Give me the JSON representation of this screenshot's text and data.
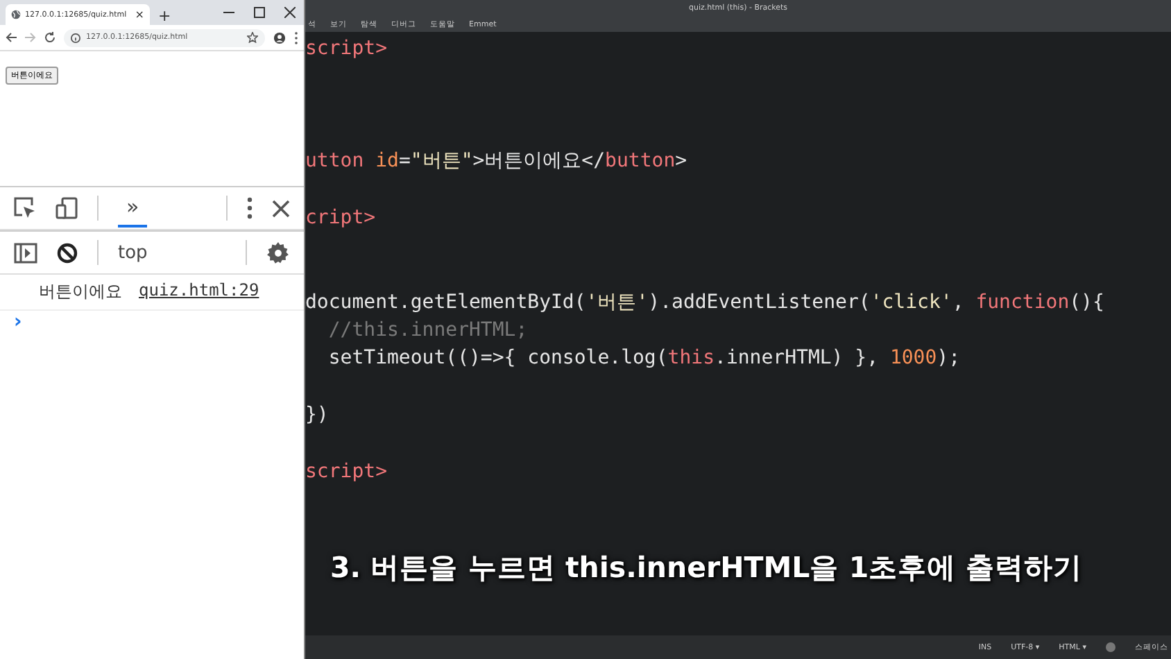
{
  "browser": {
    "tab_title": "127.0.0.1:12685/quiz.html",
    "tab_close": "×",
    "new_tab": "+",
    "address": "127.0.0.1:12685/quiz.html",
    "page_button": "버튼이에요"
  },
  "devtools": {
    "tabs": [
      {
        "label": "»",
        "selected": true
      }
    ],
    "context": "top",
    "console": [
      {
        "message": "버튼이에요",
        "source": "quiz.html:29"
      }
    ],
    "prompt": "›"
  },
  "editor": {
    "title": "quiz.html (this) - Brackets",
    "menu": [
      "석",
      "보기",
      "탐색",
      "디버그",
      "도움말",
      "Emmet"
    ],
    "lines": [
      {
        "kind": "code",
        "tokens": [
          {
            "kind": "tag",
            "text": "script>"
          }
        ]
      },
      {
        "kind": "blank"
      },
      {
        "kind": "blank"
      },
      {
        "kind": "blank"
      },
      {
        "kind": "code",
        "tokens": [
          {
            "kind": "tag",
            "text": "utton"
          },
          {
            "kind": "attr",
            "text": " id"
          },
          {
            "kind": "plain",
            "text": "="
          },
          {
            "kind": "string",
            "text": "\"버튼\""
          },
          {
            "kind": "plain",
            "text": ">버튼이에요</"
          },
          {
            "kind": "tag",
            "text": "button"
          },
          {
            "kind": "plain",
            "text": ">"
          }
        ]
      },
      {
        "kind": "blank"
      },
      {
        "kind": "code",
        "tokens": [
          {
            "kind": "tag",
            "text": "cript>"
          }
        ]
      },
      {
        "kind": "blank"
      },
      {
        "kind": "blank"
      },
      {
        "kind": "code",
        "tokens": [
          {
            "kind": "plain",
            "text": "document.getElementById("
          },
          {
            "kind": "string",
            "text": "'버튼'"
          },
          {
            "kind": "plain",
            "text": ").addEventListener("
          },
          {
            "kind": "string",
            "text": "'click'"
          },
          {
            "kind": "plain",
            "text": ", "
          },
          {
            "kind": "keyword",
            "text": "function"
          },
          {
            "kind": "plain",
            "text": "(){"
          }
        ]
      },
      {
        "kind": "code",
        "tokens": [
          {
            "kind": "comment",
            "text": "  //this.innerHTML;"
          }
        ]
      },
      {
        "kind": "code",
        "tokens": [
          {
            "kind": "plain",
            "text": "  setTimeout(()=>{ console.log("
          },
          {
            "kind": "keyword",
            "text": "this"
          },
          {
            "kind": "plain",
            "text": ".innerHTML) }, "
          },
          {
            "kind": "number",
            "text": "1000"
          },
          {
            "kind": "plain",
            "text": ");"
          }
        ]
      },
      {
        "kind": "blank"
      },
      {
        "kind": "code",
        "tokens": [
          {
            "kind": "plain",
            "text": "})"
          }
        ]
      },
      {
        "kind": "blank"
      },
      {
        "kind": "code",
        "tokens": [
          {
            "kind": "tag",
            "text": "script>"
          }
        ]
      }
    ],
    "status": [
      "INS",
      "UTF-8 ▾",
      "HTML ▾",
      "스페이스"
    ]
  },
  "caption": "3. 버튼을 누르면 this.innerHTML을 1초후에 출력하기"
}
